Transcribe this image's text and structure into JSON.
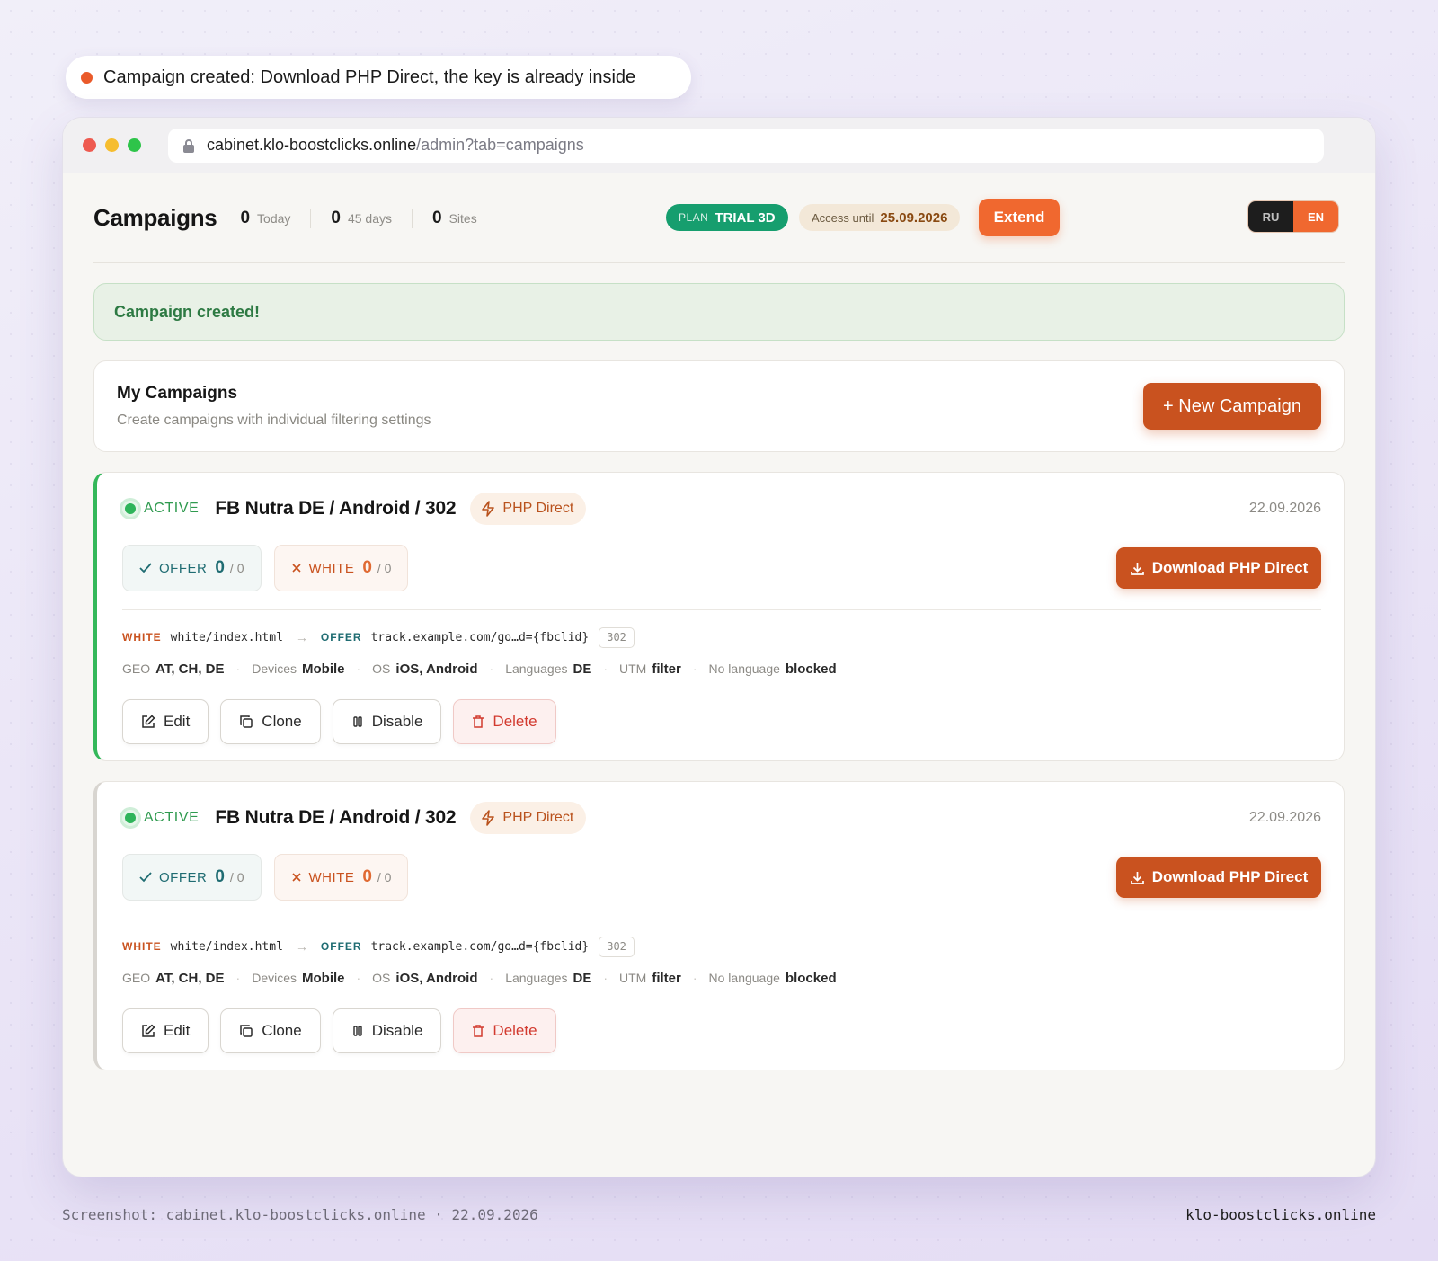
{
  "toast": {
    "text": "Campaign created: Download PHP Direct, the key is already inside"
  },
  "browser": {
    "url_host": "cabinet.klo-boostclicks.online",
    "url_path": "/admin?tab=campaigns"
  },
  "header": {
    "title": "Campaigns",
    "stats": [
      {
        "value": "0",
        "label": "Today"
      },
      {
        "value": "0",
        "label": "45 days"
      },
      {
        "value": "0",
        "label": "Sites"
      }
    ],
    "plan_label": "PLAN",
    "plan_value": "TRIAL 3D",
    "access_label": "Access until",
    "access_date": "25.09.2026",
    "extend_label": "Extend",
    "lang_ru": "RU",
    "lang_en": "EN"
  },
  "alert": {
    "text": "Campaign created!"
  },
  "my_campaigns": {
    "title": "My Campaigns",
    "subtitle": "Create campaigns with individual filtering settings",
    "new_button": "+ New Campaign"
  },
  "campaigns": [
    {
      "status": "ACTIVE",
      "name": "FB Nutra DE / Android / 302",
      "type": "PHP Direct",
      "date": "22.09.2026",
      "offer_label": "OFFER",
      "offer_count": "0",
      "offer_total": "/ 0",
      "white_label": "WHITE",
      "white_count": "0",
      "white_total": "/ 0",
      "download_label": "Download PHP Direct",
      "route_white_label": "WHITE",
      "route_white": "white/index.html",
      "route_offer_label": "OFFER",
      "route_offer": "track.example.com/go…d={fbclid}",
      "route_code": "302",
      "geo_key": "GEO",
      "geo": "AT, CH, DE",
      "devices_key": "Devices",
      "devices": "Mobile",
      "os_key": "OS",
      "os": "iOS, Android",
      "languages_key": "Languages",
      "languages": "DE",
      "utm_key": "UTM",
      "utm": "filter",
      "nolang_key": "No language",
      "nolang": "blocked",
      "edit": "Edit",
      "clone": "Clone",
      "disable": "Disable",
      "delete": "Delete"
    },
    {
      "status": "ACTIVE",
      "name": "FB Nutra DE / Android / 302",
      "type": "PHP Direct",
      "date": "22.09.2026",
      "offer_label": "OFFER",
      "offer_count": "0",
      "offer_total": "/ 0",
      "white_label": "WHITE",
      "white_count": "0",
      "white_total": "/ 0",
      "download_label": "Download PHP Direct",
      "route_white_label": "WHITE",
      "route_white": "white/index.html",
      "route_offer_label": "OFFER",
      "route_offer": "track.example.com/go…d={fbclid}",
      "route_code": "302",
      "geo_key": "GEO",
      "geo": "AT, CH, DE",
      "devices_key": "Devices",
      "devices": "Mobile",
      "os_key": "OS",
      "os": "iOS, Android",
      "languages_key": "Languages",
      "languages": "DE",
      "utm_key": "UTM",
      "utm": "filter",
      "nolang_key": "No language",
      "nolang": "blocked",
      "edit": "Edit",
      "clone": "Clone",
      "disable": "Disable",
      "delete": "Delete"
    }
  ],
  "footer": {
    "left": "Screenshot: cabinet.klo-boostclicks.online · 22.09.2026",
    "right": "klo-boostclicks.online"
  },
  "colors": {
    "accent": "#c9521f",
    "active": "#2eb45a",
    "plan": "#169e6e"
  }
}
